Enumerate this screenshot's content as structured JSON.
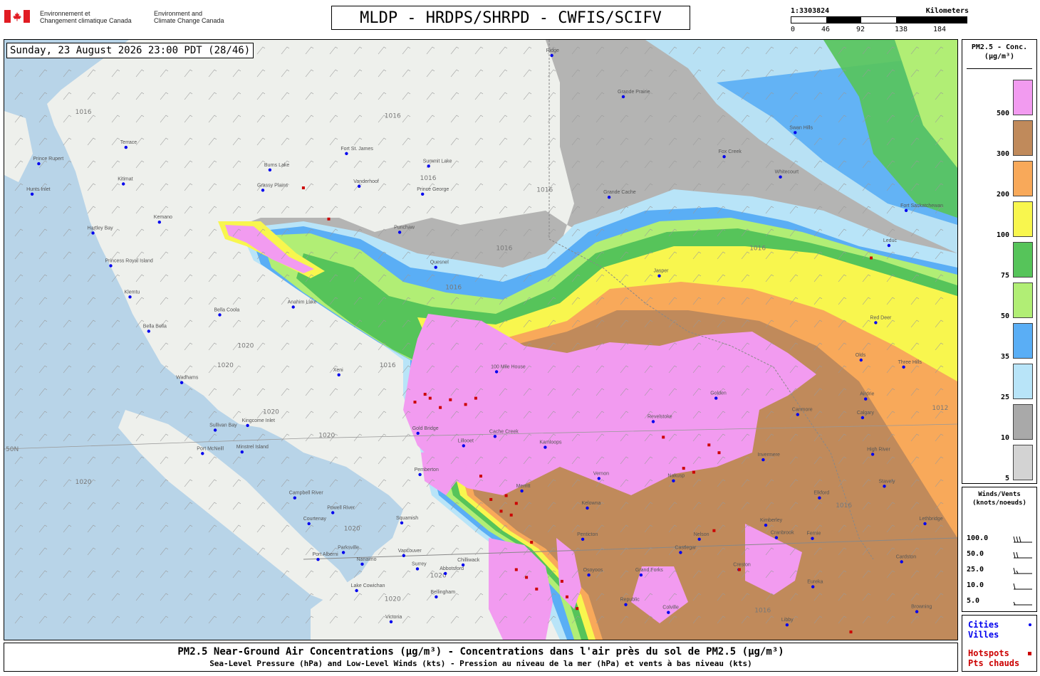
{
  "header": {
    "agency_fr_line1": "Environnement et",
    "agency_fr_line2": "Changement climatique Canada",
    "agency_en_line1": "Environment and",
    "agency_en_line2": "Climate Change Canada",
    "product_title": "MLDP - HRDPS/SHRPD - CWFIS/SCIFV"
  },
  "scale": {
    "ratio": "1:3303824",
    "unit": "Kilometers",
    "ticks": [
      "0",
      "46",
      "92",
      "138",
      "184"
    ]
  },
  "timestamp": "Sunday, 23 August 2026 23:00 PDT (28/46)",
  "legend": {
    "title_line1": "PM2.5 - Conc.",
    "title_line2": "(µg/m³)",
    "levels": [
      {
        "label": "500",
        "color": "#f29bf0"
      },
      {
        "label": "300",
        "color": "#c08a5b"
      },
      {
        "label": "200",
        "color": "#f8a95a"
      },
      {
        "label": "100",
        "color": "#f8f64e"
      },
      {
        "label": "75",
        "color": "#56c45a"
      },
      {
        "label": "50",
        "color": "#b1ee75"
      },
      {
        "label": "35",
        "color": "#5aaef5"
      },
      {
        "label": "25",
        "color": "#b8e4f8"
      },
      {
        "label": "10",
        "color": "#a9a9a9"
      },
      {
        "label": "5",
        "color": "#d3d3d3"
      }
    ]
  },
  "winds_legend": {
    "title_line1": "Winds/Vents",
    "title_line2": "(knots/noeuds)",
    "entries": [
      "100.0",
      "50.0",
      "25.0",
      "10.0",
      "5.0"
    ]
  },
  "markers": {
    "cities_en": "Cities",
    "cities_fr": "Villes",
    "cities_color": "#0000ee",
    "hotspots_en": "Hotspots",
    "hotspots_fr": "Pts chauds",
    "hotspots_color": "#cc0000"
  },
  "map": {
    "places": [
      {
        "name": "Prince Rupert",
        "lon": -130.32,
        "lat": 54.31
      },
      {
        "name": "Terrace",
        "lon": -128.6,
        "lat": 54.52
      },
      {
        "name": "Kitimat",
        "lon": -128.65,
        "lat": 54.05
      },
      {
        "name": "Hartley Bay",
        "lon": -129.25,
        "lat": 53.42
      },
      {
        "name": "Kemano",
        "lon": -127.94,
        "lat": 53.56
      },
      {
        "name": "Klemtu",
        "lon": -128.52,
        "lat": 52.6
      },
      {
        "name": "Bella Bella",
        "lon": -128.15,
        "lat": 52.16
      },
      {
        "name": "Bella Coola",
        "lon": -126.75,
        "lat": 52.37
      },
      {
        "name": "Anahim Lake",
        "lon": -125.3,
        "lat": 52.47
      },
      {
        "name": "Burns Lake",
        "lon": -125.76,
        "lat": 54.23
      },
      {
        "name": "Fort St. James",
        "lon": -124.25,
        "lat": 54.44
      },
      {
        "name": "Vanderhoof",
        "lon": -124.0,
        "lat": 54.02
      },
      {
        "name": "Prince George",
        "lon": -122.75,
        "lat": 53.92
      },
      {
        "name": "Summit Lake",
        "lon": -122.63,
        "lat": 54.28
      },
      {
        "name": "Punchaw",
        "lon": -123.2,
        "lat": 53.43
      },
      {
        "name": "Quesnel",
        "lon": -122.49,
        "lat": 52.98
      },
      {
        "name": "Grande Cache",
        "lon": -119.07,
        "lat": 53.88
      },
      {
        "name": "Grande Prairie",
        "lon": -118.79,
        "lat": 55.17
      },
      {
        "name": "Swan Hills",
        "lon": -115.4,
        "lat": 54.71
      },
      {
        "name": "Fox Creek",
        "lon": -116.8,
        "lat": 54.4
      },
      {
        "name": "Whitecourt",
        "lon": -115.69,
        "lat": 54.14
      },
      {
        "name": "Fort Saskatchewan",
        "lon": -113.21,
        "lat": 53.71
      },
      {
        "name": "Leduc",
        "lon": -113.55,
        "lat": 53.26
      },
      {
        "name": "Jasper",
        "lon": -118.08,
        "lat": 52.87
      },
      {
        "name": "Red Deer",
        "lon": -113.81,
        "lat": 52.27
      },
      {
        "name": "Three Hills",
        "lon": -113.26,
        "lat": 51.7
      },
      {
        "name": "Olds",
        "lon": -114.1,
        "lat": 51.79
      },
      {
        "name": "Airdrie",
        "lon": -114.01,
        "lat": 51.29
      },
      {
        "name": "Calgary",
        "lon": -114.07,
        "lat": 51.05
      },
      {
        "name": "Canmore",
        "lon": -115.35,
        "lat": 51.09
      },
      {
        "name": "High River",
        "lon": -113.87,
        "lat": 50.58
      },
      {
        "name": "Stavely",
        "lon": -113.64,
        "lat": 50.17
      },
      {
        "name": "100 Mile House",
        "lon": -121.29,
        "lat": 51.64
      },
      {
        "name": "Xeni",
        "lon": -124.4,
        "lat": 51.6
      },
      {
        "name": "Wadhams",
        "lon": -127.5,
        "lat": 51.5
      },
      {
        "name": "Kingcome Inlet",
        "lon": -126.2,
        "lat": 50.95
      },
      {
        "name": "Sullivan Bay",
        "lon": -126.84,
        "lat": 50.89
      },
      {
        "name": "Port McNeill",
        "lon": -127.09,
        "lat": 50.59
      },
      {
        "name": "Minstrel Island",
        "lon": -126.31,
        "lat": 50.61
      },
      {
        "name": "Gold Bridge",
        "lon": -122.84,
        "lat": 50.85
      },
      {
        "name": "Cache Creek",
        "lon": -121.32,
        "lat": 50.81
      },
      {
        "name": "Kamloops",
        "lon": -120.33,
        "lat": 50.67
      },
      {
        "name": "Revelstoke",
        "lon": -118.2,
        "lat": 51.0
      },
      {
        "name": "Golden",
        "lon": -116.96,
        "lat": 51.3
      },
      {
        "name": "Lillooet",
        "lon": -121.94,
        "lat": 50.69
      },
      {
        "name": "Pemberton",
        "lon": -122.8,
        "lat": 50.32
      },
      {
        "name": "Merritt",
        "lon": -120.79,
        "lat": 50.11
      },
      {
        "name": "Vernon",
        "lon": -119.27,
        "lat": 50.27
      },
      {
        "name": "Nakusp",
        "lon": -117.8,
        "lat": 50.24
      },
      {
        "name": "Invermere",
        "lon": -116.03,
        "lat": 50.51
      },
      {
        "name": "Elkford",
        "lon": -114.92,
        "lat": 50.02
      },
      {
        "name": "Fernie",
        "lon": -115.06,
        "lat": 49.5
      },
      {
        "name": "Kimberley",
        "lon": -115.98,
        "lat": 49.67
      },
      {
        "name": "Cranbrook",
        "lon": -115.77,
        "lat": 49.51
      },
      {
        "name": "Kelowna",
        "lon": -119.5,
        "lat": 49.89
      },
      {
        "name": "Penticton",
        "lon": -119.59,
        "lat": 49.49
      },
      {
        "name": "Osoyoos",
        "lon": -119.47,
        "lat": 49.03
      },
      {
        "name": "Grand Forks",
        "lon": -118.44,
        "lat": 49.03
      },
      {
        "name": "Nelson",
        "lon": -117.29,
        "lat": 49.49
      },
      {
        "name": "Castlegar",
        "lon": -117.66,
        "lat": 49.32
      },
      {
        "name": "Creston",
        "lon": -116.51,
        "lat": 49.1
      },
      {
        "name": "Campbell River",
        "lon": -125.27,
        "lat": 50.02
      },
      {
        "name": "Powell River",
        "lon": -124.52,
        "lat": 49.83
      },
      {
        "name": "Courtenay",
        "lon": -124.99,
        "lat": 49.69
      },
      {
        "name": "Squamish",
        "lon": -123.16,
        "lat": 49.7
      },
      {
        "name": "Port Alberni",
        "lon": -124.81,
        "lat": 49.23
      },
      {
        "name": "Parksville",
        "lon": -124.31,
        "lat": 49.32
      },
      {
        "name": "Nanaimo",
        "lon": -123.94,
        "lat": 49.17
      },
      {
        "name": "Vancouver",
        "lon": -123.12,
        "lat": 49.28
      },
      {
        "name": "Surrey",
        "lon": -122.85,
        "lat": 49.11
      },
      {
        "name": "Abbotsford",
        "lon": -122.3,
        "lat": 49.05
      },
      {
        "name": "Chilliwack",
        "lon": -121.95,
        "lat": 49.16
      },
      {
        "name": "Lake Cowichan",
        "lon": -124.05,
        "lat": 48.83
      },
      {
        "name": "Victoria",
        "lon": -123.37,
        "lat": 48.43
      },
      {
        "name": "Bellingham",
        "lon": -122.48,
        "lat": 48.75
      },
      {
        "name": "Republic",
        "lon": -118.74,
        "lat": 48.65
      },
      {
        "name": "Colville",
        "lon": -117.9,
        "lat": 48.55
      },
      {
        "name": "Libby",
        "lon": -115.56,
        "lat": 48.39
      },
      {
        "name": "Eureka",
        "lon": -115.05,
        "lat": 48.88
      },
      {
        "name": "Princess Royal Island",
        "lon": -128.9,
        "lat": 53.0
      },
      {
        "name": "Ridge",
        "lon": -120.2,
        "lat": 55.7
      },
      {
        "name": "Hunts Inlet",
        "lon": -130.45,
        "lat": 53.92
      },
      {
        "name": "Grassy Plains",
        "lon": -125.9,
        "lat": 53.97
      },
      {
        "name": "Cardston",
        "lon": -113.3,
        "lat": 49.2
      },
      {
        "name": "Lethbridge",
        "lon": -112.84,
        "lat": 49.69
      },
      {
        "name": "Browning",
        "lon": -113.0,
        "lat": 48.56
      }
    ],
    "isobar_labels": [
      {
        "text": "1016",
        "lon": -129.6,
        "lat": 54.95
      },
      {
        "text": "1016",
        "lon": -123.5,
        "lat": 54.9
      },
      {
        "text": "1016",
        "lon": -122.8,
        "lat": 54.1
      },
      {
        "text": "1016",
        "lon": -120.5,
        "lat": 53.95
      },
      {
        "text": "1016",
        "lon": -121.3,
        "lat": 53.2
      },
      {
        "text": "1016",
        "lon": -122.3,
        "lat": 52.7
      },
      {
        "text": "1016",
        "lon": -116.3,
        "lat": 53.2
      },
      {
        "text": "1016",
        "lon": -123.6,
        "lat": 51.7
      },
      {
        "text": "1020",
        "lon": -126.4,
        "lat": 51.95
      },
      {
        "text": "1020",
        "lon": -126.8,
        "lat": 51.7
      },
      {
        "text": "1020",
        "lon": -125.9,
        "lat": 51.1
      },
      {
        "text": "1020",
        "lon": -124.8,
        "lat": 50.8
      },
      {
        "text": "1020",
        "lon": -129.6,
        "lat": 50.2
      },
      {
        "text": "1020",
        "lon": -124.3,
        "lat": 49.6
      },
      {
        "text": "1020",
        "lon": -122.6,
        "lat": 49.0
      },
      {
        "text": "1020",
        "lon": -123.5,
        "lat": 48.7
      },
      {
        "text": "1016",
        "lon": -114.6,
        "lat": 49.9
      },
      {
        "text": "1016",
        "lon": -116.2,
        "lat": 48.55
      },
      {
        "text": "1012",
        "lon": -112.7,
        "lat": 51.15
      }
    ],
    "hotspots": [
      {
        "lon": -122.9,
        "lat": 51.25
      },
      {
        "lon": -122.6,
        "lat": 51.3
      },
      {
        "lon": -122.2,
        "lat": 51.28
      },
      {
        "lon": -122.4,
        "lat": 51.18
      },
      {
        "lon": -121.9,
        "lat": 51.22
      },
      {
        "lon": -121.7,
        "lat": 51.3
      },
      {
        "lon": -122.7,
        "lat": 51.35
      },
      {
        "lon": -121.6,
        "lat": 50.3
      },
      {
        "lon": -121.4,
        "lat": 50.0
      },
      {
        "lon": -121.1,
        "lat": 50.05
      },
      {
        "lon": -120.9,
        "lat": 49.95
      },
      {
        "lon": -121.2,
        "lat": 49.85
      },
      {
        "lon": -121.0,
        "lat": 49.8
      },
      {
        "lon": -118.0,
        "lat": 50.8
      },
      {
        "lon": -117.1,
        "lat": 50.7
      },
      {
        "lon": -116.9,
        "lat": 50.6
      },
      {
        "lon": -117.6,
        "lat": 50.4
      },
      {
        "lon": -117.4,
        "lat": 50.35
      },
      {
        "lon": -120.6,
        "lat": 49.45
      },
      {
        "lon": -120.9,
        "lat": 49.1
      },
      {
        "lon": -120.7,
        "lat": 49.0
      },
      {
        "lon": -120.5,
        "lat": 48.85
      },
      {
        "lon": -120.0,
        "lat": 48.95
      },
      {
        "lon": -119.9,
        "lat": 48.75
      },
      {
        "lon": -119.7,
        "lat": 48.6
      },
      {
        "lon": -125.1,
        "lat": 54.0
      },
      {
        "lon": -124.6,
        "lat": 53.6
      },
      {
        "lon": -117.0,
        "lat": 49.6
      },
      {
        "lon": -116.5,
        "lat": 49.1
      },
      {
        "lon": -113.9,
        "lat": 53.1
      },
      {
        "lon": -114.3,
        "lat": 48.3
      }
    ]
  }
}
